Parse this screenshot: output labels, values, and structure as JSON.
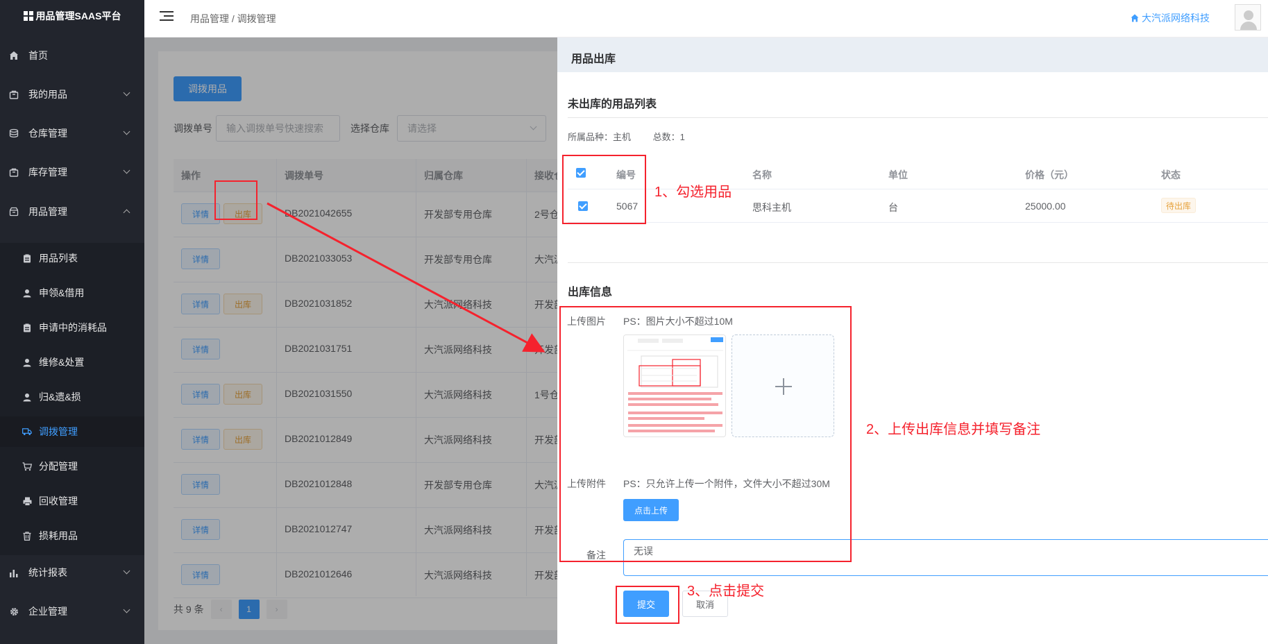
{
  "app": {
    "title": "用品管理SAAS平台"
  },
  "sidebar": {
    "items": [
      {
        "label": "首页",
        "icon": "home-icon"
      },
      {
        "label": "我的用品",
        "icon": "bag-icon"
      },
      {
        "label": "仓库管理",
        "icon": "database-icon"
      },
      {
        "label": "库存管理",
        "icon": "bag-icon"
      },
      {
        "label": "用品管理",
        "icon": "box-icon"
      }
    ],
    "sub_items": [
      {
        "label": "用品列表",
        "icon": "clipboard-icon"
      },
      {
        "label": "申领&借用",
        "icon": "user-icon"
      },
      {
        "label": "申请中的消耗品",
        "icon": "clipboard-icon"
      },
      {
        "label": "维修&处置",
        "icon": "user-icon"
      },
      {
        "label": "归&遗&损",
        "icon": "user-icon"
      },
      {
        "label": "调拨管理",
        "icon": "truck-icon"
      },
      {
        "label": "分配管理",
        "icon": "cart-icon"
      },
      {
        "label": "回收管理",
        "icon": "printer-icon"
      },
      {
        "label": "损耗用品",
        "icon": "trash-icon"
      }
    ],
    "bottom_items": [
      {
        "label": "统计报表",
        "icon": "chart-icon"
      },
      {
        "label": "企业管理",
        "icon": "gear-icon"
      }
    ]
  },
  "header": {
    "breadcrumb": "用品管理 / 调拨管理",
    "company": "大汽派网络科技"
  },
  "page": {
    "transfer_button": "调拨用品",
    "filter_no_label": "调拨单号",
    "filter_no_placeholder": "输入调拨单号快速搜索",
    "filter_wh_label": "选择仓库",
    "filter_wh_placeholder": "请选择",
    "columns": [
      "操作",
      "调拨单号",
      "归属仓库",
      "接收仓"
    ],
    "detail_label": "详情",
    "out_label": "出库",
    "rows": [
      {
        "no": "DB2021042655",
        "wh": "开发部专用仓库",
        "recv": "2号仓",
        "out": true
      },
      {
        "no": "DB2021033053",
        "wh": "开发部专用仓库",
        "recv": "大汽派",
        "out": false
      },
      {
        "no": "DB2021031852",
        "wh": "大汽派网络科技",
        "recv": "开发部",
        "out": true
      },
      {
        "no": "DB2021031751",
        "wh": "大汽派网络科技",
        "recv": "开发部",
        "out": false
      },
      {
        "no": "DB2021031550",
        "wh": "大汽派网络科技",
        "recv": "1号仓",
        "out": true
      },
      {
        "no": "DB2021012849",
        "wh": "大汽派网络科技",
        "recv": "开发部",
        "out": true
      },
      {
        "no": "DB2021012848",
        "wh": "开发部专用仓库",
        "recv": "大汽派",
        "out": false
      },
      {
        "no": "DB2021012747",
        "wh": "大汽派网络科技",
        "recv": "开发部",
        "out": false
      },
      {
        "no": "DB2021012646",
        "wh": "大汽派网络科技",
        "recv": "开发部",
        "out": false
      }
    ],
    "total": "共 9 条",
    "current_page": "1"
  },
  "drawer": {
    "title": "用品出库",
    "list_title": "未出库的用品列表",
    "category": "所属品种：主机",
    "count": "总数：1",
    "columns": [
      "编号",
      "名称",
      "单位",
      "价格（元）",
      "状态"
    ],
    "row": {
      "no": "5067",
      "name": "思科主机",
      "unit": "台",
      "price": "25000.00",
      "status": "待出库"
    },
    "info_title": "出库信息",
    "upload_image_label": "上传图片",
    "upload_image_hint": "PS：图片大小不超过10M",
    "upload_file_label": "上传附件",
    "upload_file_hint": "PS：只允许上传一个附件，文件大小不超过30M",
    "upload_button": "点击上传",
    "remark_label": "备注",
    "remark_value": "无误",
    "submit": "提交",
    "cancel": "取消"
  },
  "annotations": {
    "step1": "1、勾选用品",
    "step2": "2、上传出库信息并填写备注",
    "step3": "3、点击提交"
  },
  "colors": {
    "primary": "#409eff",
    "sidebar": "#22252d",
    "annotation": "#f5222d",
    "warning": "#e6a23c"
  }
}
